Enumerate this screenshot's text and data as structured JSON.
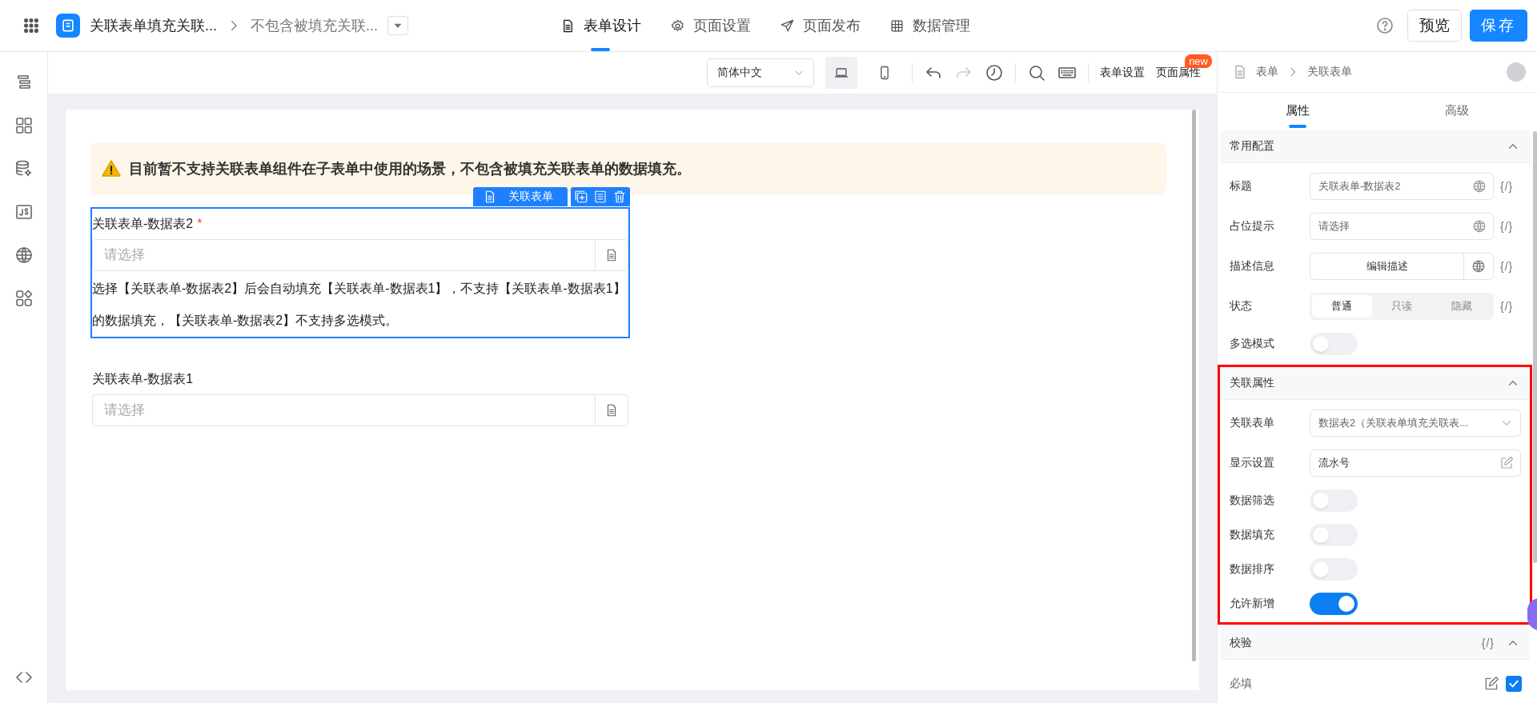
{
  "app_bar": {
    "app_title": "关联表单填充关联...",
    "page_title": "不包含被填充关联...",
    "nav_tabs": [
      {
        "label": "表单设计",
        "kind": "doc",
        "selected": true
      },
      {
        "label": "页面设置",
        "kind": "gear",
        "selected": false
      },
      {
        "label": "页面发布",
        "kind": "send",
        "selected": false
      },
      {
        "label": "数据管理",
        "kind": "table",
        "selected": false
      }
    ],
    "preview_button": "预览",
    "save_button": "保存"
  },
  "toolbar": {
    "language": "简体中文",
    "devices": [
      {
        "kind": "desktop",
        "selected": true
      },
      {
        "kind": "mobile",
        "selected": false
      }
    ],
    "history": [
      {
        "kind": "undo",
        "disabled": false
      },
      {
        "kind": "redo",
        "disabled": true
      }
    ],
    "links": [
      {
        "label": "表单设置"
      },
      {
        "label": "页面属性",
        "badge": "new"
      }
    ]
  },
  "canvas": {
    "alert": "目前暂不支持关联表单组件在子表单中使用的场景，不包含被填充关联表单的数据填充。",
    "fields": [
      {
        "label": "关联表单-数据表2",
        "required_mark": "*",
        "selected": true,
        "tag": "关联表单",
        "placeholder": "请选择",
        "description": "选择【关联表单-数据表2】后会自动填充【关联表单-数据表1】，不支持【关联表单-数据表1】的数据填充，【关联表单-数据表2】不支持多选模式。"
      },
      {
        "label": "关联表单-数据表1",
        "selected": false,
        "placeholder": "请选择"
      }
    ]
  },
  "panel": {
    "breadcrumb": [
      "表单",
      "关联表单"
    ],
    "tabs": [
      {
        "label": "属性",
        "selected": true
      },
      {
        "label": "高级",
        "selected": false
      }
    ],
    "sections": [
      {
        "title": "常用配置",
        "expanded": true,
        "highlighted": false,
        "rows": [
          {
            "kind": "input",
            "label": "标题",
            "value": "关联表单-数据表2",
            "binding": "{/}"
          },
          {
            "kind": "input",
            "label": "占位提示",
            "value": "请选择",
            "binding": "{/}"
          },
          {
            "kind": "button",
            "label": "描述信息",
            "value": "编辑描述",
            "binding": "{/}"
          },
          {
            "kind": "segmented",
            "label": "状态",
            "options": [
              {
                "label": "普通",
                "selected": true
              },
              {
                "label": "只读",
                "selected": false
              },
              {
                "label": "隐藏",
                "selected": false
              }
            ],
            "binding": "{/}"
          },
          {
            "kind": "switch",
            "label": "多选模式",
            "on": false
          }
        ]
      },
      {
        "title": "关联属性",
        "expanded": true,
        "highlighted": true,
        "rows": [
          {
            "kind": "select",
            "label": "关联表单",
            "value": "数据表2（关联表单填充关联表..."
          },
          {
            "kind": "edit",
            "label": "显示设置",
            "value": "流水号"
          },
          {
            "kind": "switch",
            "label": "数据筛选",
            "on": false
          },
          {
            "kind": "switch",
            "label": "数据填充",
            "on": false
          },
          {
            "kind": "switch",
            "label": "数据排序",
            "on": false
          },
          {
            "kind": "switch",
            "label": "允许新增",
            "on": true
          }
        ]
      },
      {
        "title": "校验",
        "binding": "{/}",
        "expanded": true,
        "highlighted": false,
        "rows": [
          {
            "kind": "check",
            "label": "必填",
            "checked": true
          }
        ]
      }
    ]
  }
}
